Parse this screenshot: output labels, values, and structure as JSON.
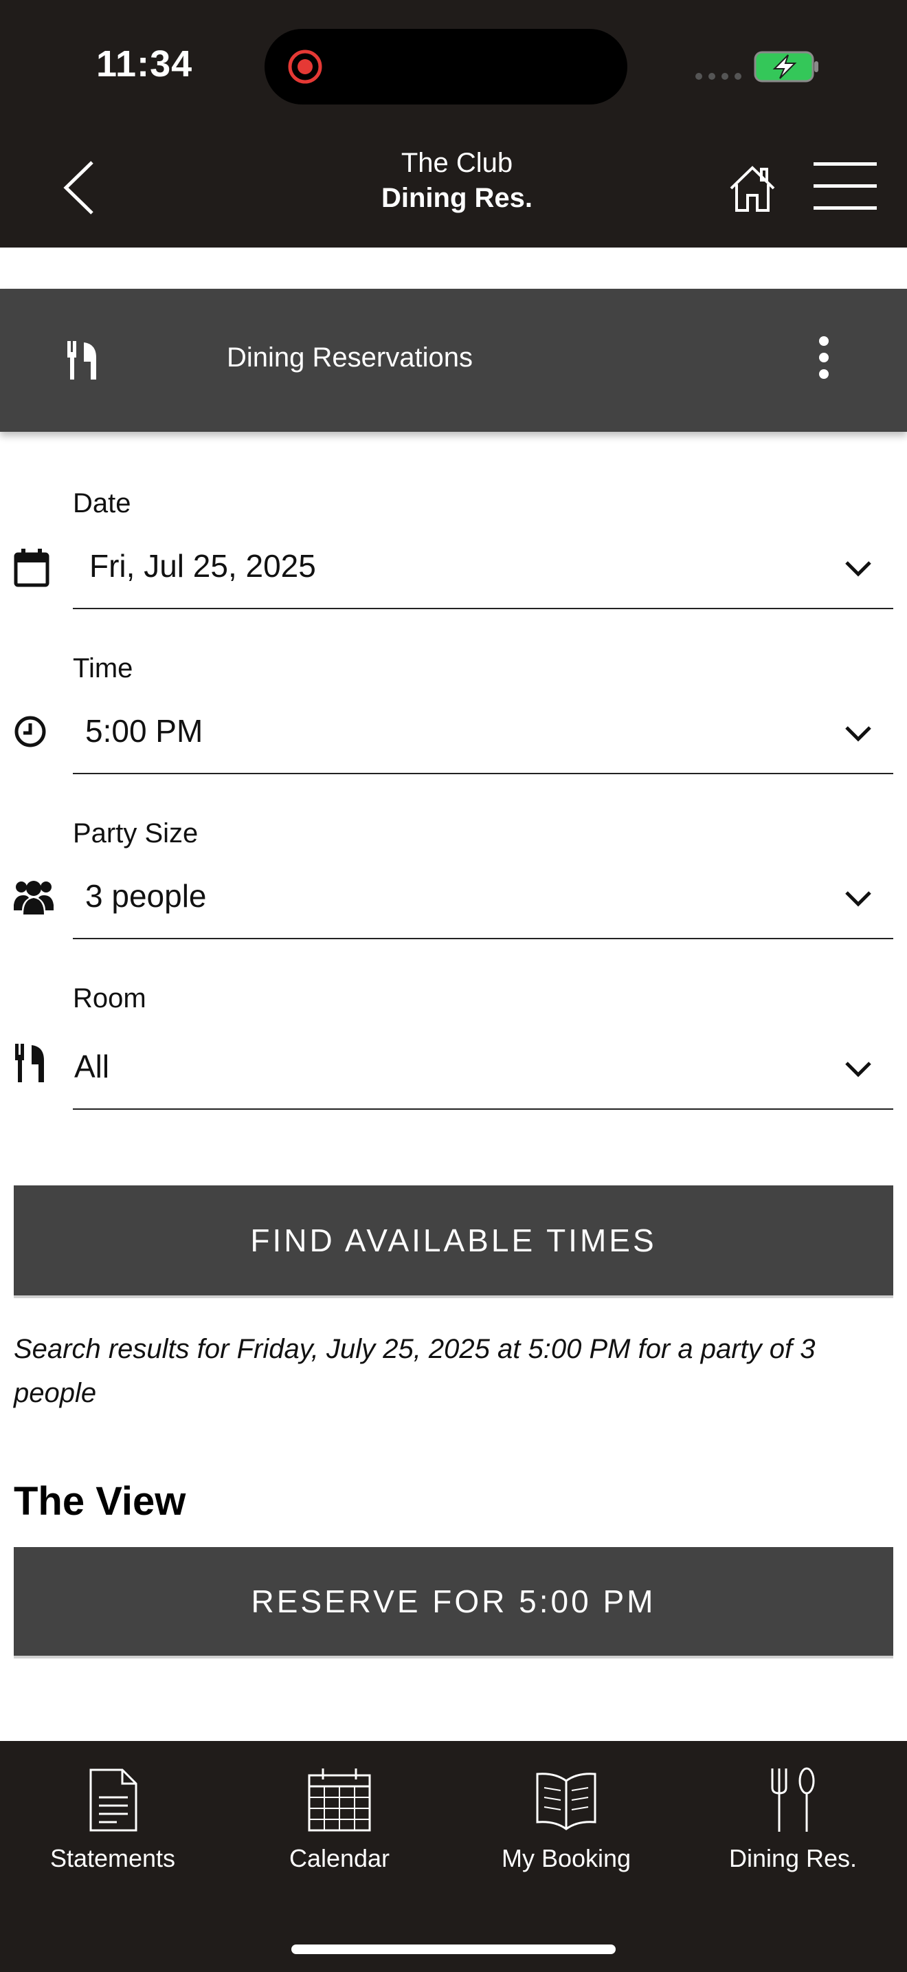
{
  "status_bar": {
    "time": "11:34",
    "recording_color": "#e53935",
    "battery_color": "#34c759"
  },
  "header": {
    "club_name": "The Club",
    "page_name": "Dining Res.",
    "icons": [
      "back-chevron-icon",
      "home-icon",
      "hamburger-menu-icon"
    ]
  },
  "section": {
    "title": "Dining Reservations",
    "icon": "fork-knife-icon",
    "menu_icon": "vertical-ellipsis-icon"
  },
  "form": {
    "date": {
      "label": "Date",
      "value": "Fri, Jul 25, 2025",
      "icon": "calendar-icon"
    },
    "time": {
      "label": "Time",
      "value": "5:00 PM",
      "icon": "clock-icon"
    },
    "party_size": {
      "label": "Party Size",
      "value": "3 people",
      "icon": "people-icon"
    },
    "room": {
      "label": "Room",
      "value": "All",
      "icon": "fork-knife-icon"
    }
  },
  "find_button": "FIND AVAILABLE TIMES",
  "results_text": "Search results for Friday, July 25, 2025 at 5:00 PM for a party of 3 people",
  "results": [
    {
      "venue": "The View",
      "reserve_label": "RESERVE FOR 5:00 PM"
    }
  ],
  "tabs": [
    {
      "label": "Statements",
      "icon": "document-icon"
    },
    {
      "label": "Calendar",
      "icon": "calendar-grid-icon"
    },
    {
      "label": "My Booking",
      "icon": "open-book-icon"
    },
    {
      "label": "Dining Res.",
      "icon": "fork-knife-icon"
    }
  ],
  "colors": {
    "header_bg": "#201c1a",
    "section_bg": "#434343",
    "button_bg": "#434343"
  }
}
